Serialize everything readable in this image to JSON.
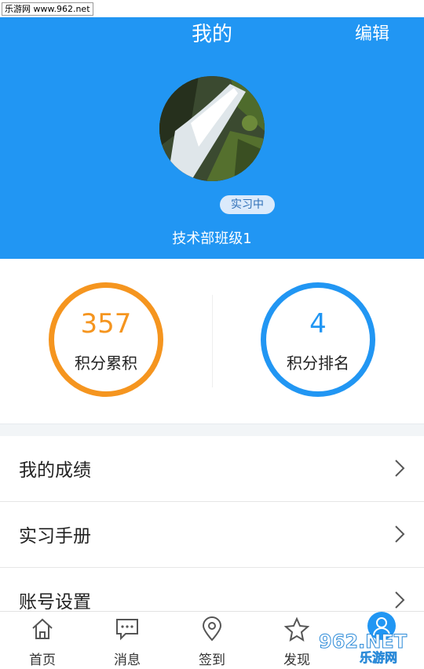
{
  "watermark_top": "乐游网 www.962.net",
  "header": {
    "title": "我的",
    "edit_label": "编辑",
    "status_badge": "实习中",
    "department": "技术部班级1"
  },
  "stats": {
    "points_total": {
      "value": "357",
      "label": "积分累积",
      "color": "#f5951f"
    },
    "points_rank": {
      "value": "4",
      "label": "积分排名",
      "color": "#2196f3"
    }
  },
  "menu": {
    "items": [
      {
        "label": "我的成绩"
      },
      {
        "label": "实习手册"
      },
      {
        "label": "账号设置"
      }
    ]
  },
  "tabbar": {
    "tabs": [
      {
        "label": "首页",
        "icon": "home-icon"
      },
      {
        "label": "消息",
        "icon": "message-icon"
      },
      {
        "label": "签到",
        "icon": "location-icon"
      },
      {
        "label": "发现",
        "icon": "star-icon"
      }
    ]
  },
  "watermark_bottom": "962.NET 乐游网",
  "colors": {
    "brand": "#2196f3",
    "accent_orange": "#f5951f"
  }
}
